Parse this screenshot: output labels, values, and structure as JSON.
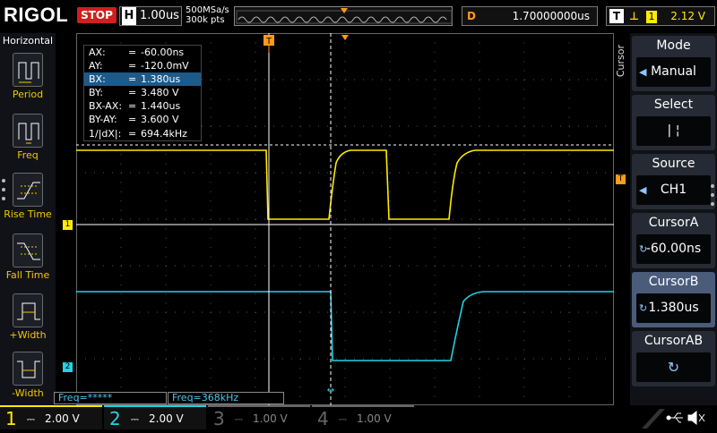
{
  "header": {
    "logo": "RIGOL",
    "run_state": "STOP",
    "timebase_label": "H",
    "timebase_value": "1.00us",
    "sample_rate": "500MSa/s",
    "memory_depth": "300k pts",
    "delay_label": "D",
    "delay_value": "1.70000000us",
    "trigger_label": "T",
    "trigger_source": "1",
    "trigger_level": "2.12 V"
  },
  "left_menu": {
    "title": "Horizontal",
    "items": [
      "Period",
      "Freq",
      "Rise Time",
      "Fall Time",
      "+Width",
      "-Width"
    ]
  },
  "right_menu": {
    "side_label": "Cursor",
    "items": [
      {
        "title": "Mode",
        "value": "Manual"
      },
      {
        "title": "Select",
        "value": "|   ¦"
      },
      {
        "title": "Source",
        "value": "CH1"
      },
      {
        "title": "CursorA",
        "value": "-60.00ns"
      },
      {
        "title": "CursorB",
        "value": "1.380us"
      },
      {
        "title": "CursorAB",
        "value": ""
      }
    ]
  },
  "measurements": [
    {
      "key": "AX:",
      "value": "-60.00ns"
    },
    {
      "key": "AY:",
      "value": "-120.0mV"
    },
    {
      "key": "BX:",
      "value": "1.380us"
    },
    {
      "key": "BY:",
      "value": "3.480 V"
    },
    {
      "key": "BX-AX:",
      "value": "1.440us"
    },
    {
      "key": "BY-AY:",
      "value": "3.600 V"
    },
    {
      "key": "1/|dX|:",
      "value": "694.4kHz"
    }
  ],
  "frequency": {
    "left": "Freq=*****",
    "right": "Freq=368kHz"
  },
  "channels": [
    {
      "num": "1",
      "scale": "2.00 V",
      "color": "#ffeb00"
    },
    {
      "num": "2",
      "scale": "2.00 V",
      "color": "#22d2e6"
    },
    {
      "num": "3",
      "scale": "1.00 V",
      "color": "#666666"
    },
    {
      "num": "4",
      "scale": "1.00 V",
      "color": "#666666"
    }
  ],
  "markers": {
    "ch1": "1",
    "ch2": "2",
    "trigger": "T"
  },
  "colors": {
    "ch1": "#ffeb00",
    "ch2": "#22d2e6",
    "trigger": "#ff9a1a",
    "cursor_a": "#ffffff",
    "cursor_b": "#ffffff"
  }
}
